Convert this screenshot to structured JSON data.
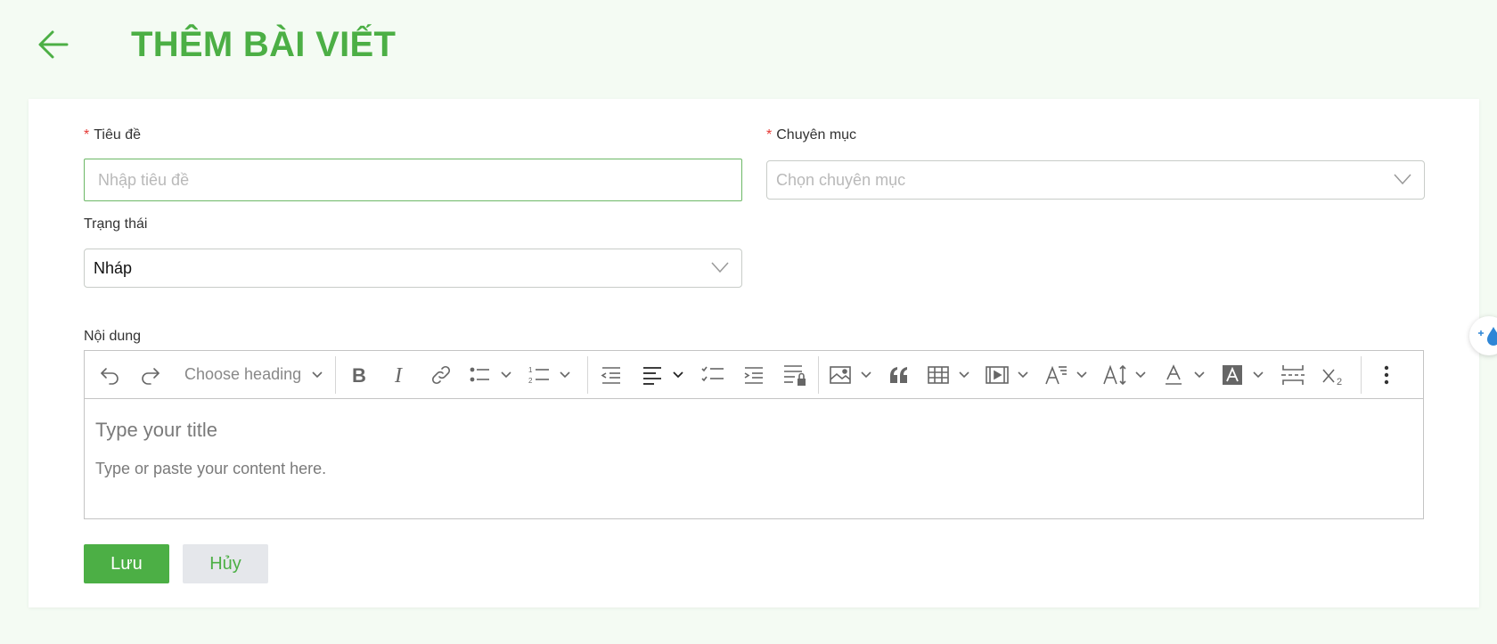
{
  "page": {
    "title": "THÊM BÀI VIẾT"
  },
  "form": {
    "title_field": {
      "label": "Tiêu đề",
      "required_mark": "*",
      "placeholder": "Nhập tiêu đề",
      "value": ""
    },
    "category_field": {
      "label": "Chuyên mục",
      "required_mark": "*",
      "placeholder": "Chọn chuyên mục"
    },
    "status_field": {
      "label": "Trạng thái",
      "value": "Nháp"
    },
    "content_field": {
      "label": "Nội dung",
      "heading_select": "Choose heading",
      "title_placeholder": "Type your title",
      "content_placeholder": "Type or paste your content here."
    }
  },
  "actions": {
    "save_label": "Lưu",
    "cancel_label": "Hủy"
  },
  "colors": {
    "accent": "#4caf45",
    "required": "#e53935",
    "cancel_bg": "#e5e7eb"
  }
}
